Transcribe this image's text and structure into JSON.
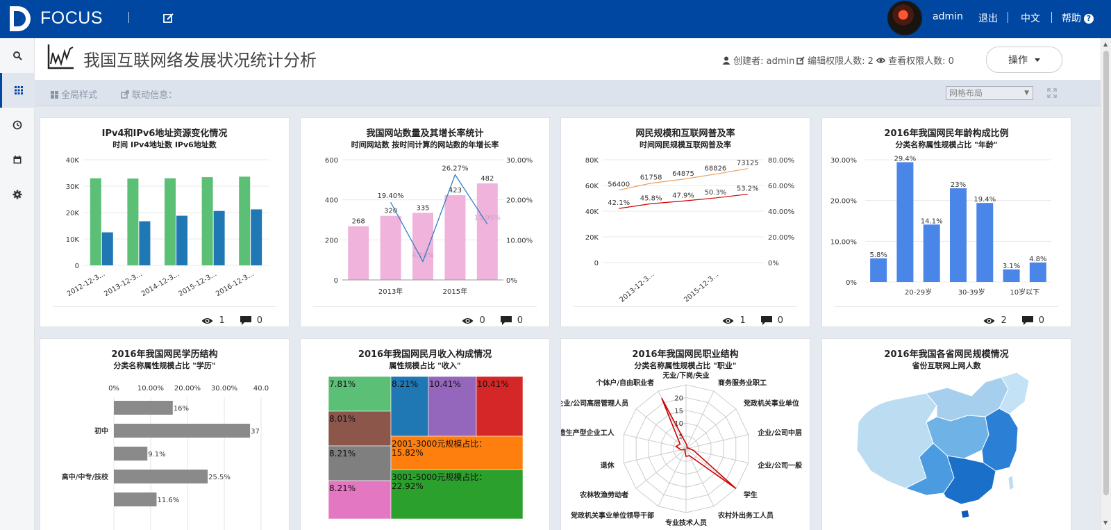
{
  "app": {
    "brand": "FOCUS"
  },
  "header": {
    "username": "admin",
    "logout": "退出",
    "language": "中文",
    "help": "帮助"
  },
  "page": {
    "title": "我国互联网络发展状况统计分析",
    "creator": "创建者: admin",
    "edit_count": "编辑权限人数: 2",
    "view_count": "查看权限人数: 0",
    "ops_button": "操作"
  },
  "toolbar": {
    "global_style": "全局样式",
    "linkage_info": "联动信息：",
    "layout_select": "网格布局"
  },
  "colors": {
    "brand": "#0047a1",
    "green": "#5bbf76",
    "blue": "#1f77b4",
    "pink": "#f0b3dc",
    "bar_blue": "#4a85e8",
    "gray_bar": "#8a8a8a",
    "red": "#cc0000",
    "orange": "#e8a25a"
  },
  "cards": [
    {
      "title": "IPv4和IPv6地址资源变化情况",
      "subtitle": "时间 IPv4地址数 IPv6地址数",
      "views": "1",
      "comments": "0",
      "chart_data": {
        "type": "bar",
        "categories": [
          "2012-12-3...",
          "2013-12-3...",
          "2014-12-3...",
          "2015-12-3...",
          "2016-12-3..."
        ],
        "series": [
          {
            "values": [
              33000,
              32900,
              33000,
              33400,
              33600
            ]
          },
          {
            "values": [
              12500,
              16700,
              18800,
              20600,
              21200
            ]
          }
        ],
        "yticks": [
          "0",
          "10K",
          "20K",
          "30K",
          "40K"
        ],
        "ylim": [
          0,
          40000
        ]
      }
    },
    {
      "title": "我国网站数量及其增长率统计",
      "subtitle": "时间网站数 按时间计算的网站数的年增长率",
      "views": "0",
      "comments": "0",
      "chart_data": {
        "type": "bar",
        "categories": [
          "",
          "2013年",
          "",
          "2015年",
          ""
        ],
        "values": [
          268,
          320,
          335,
          423,
          482
        ],
        "value_labels": [
          "268",
          "320",
          "335",
          "423",
          "482"
        ],
        "line": {
          "values": [
            null,
            19.4,
            4.6,
            26.27,
            13.95
          ],
          "labels": [
            "",
            "19.40%",
            "4.58%",
            "26.27%",
            "13.95%"
          ]
        },
        "yticks": [
          "0",
          "200",
          "400",
          "600"
        ],
        "ylim": [
          0,
          600
        ],
        "y2ticks": [
          "0%",
          "10.00%",
          "20.00%",
          "30.00%"
        ],
        "y2lim": [
          0,
          30
        ]
      }
    },
    {
      "title": "网民规模和互联网普及率",
      "subtitle": "时间网民规模互联网普及率",
      "views": "1",
      "comments": "0",
      "chart_data": {
        "type": "line",
        "categories": [
          "",
          "2013-12-3...",
          "",
          "2015-12-3...",
          ""
        ],
        "series": [
          {
            "values": [
              56400,
              61758,
              64875,
              68826,
              73125
            ],
            "labels": [
              "56400",
              "61758",
              "64875",
              "68826",
              "73125"
            ]
          },
          {
            "values": [
              42.1,
              45.8,
              47.9,
              50.3,
              53.2
            ],
            "labels": [
              "42.1%",
              "45.8%",
              "47.9%",
              "50.3%",
              "53.2%"
            ]
          }
        ],
        "yticks": [
          "0",
          "20K",
          "40K",
          "60K",
          "80K"
        ],
        "ylim": [
          0,
          80000
        ],
        "y2ticks": [
          "0%",
          "20.00%",
          "40.00%",
          "60.00%",
          "80.00%"
        ],
        "y2lim": [
          0,
          80
        ]
      }
    },
    {
      "title": "2016年我国网民年龄构成比例",
      "subtitle": "分类名称属性规模占比 \"年龄\"",
      "views": "2",
      "comments": "0",
      "chart_data": {
        "type": "bar",
        "categories": [
          "",
          "20-29岁",
          "",
          "30-39岁",
          "",
          "10岁以下",
          ""
        ],
        "values": [
          5.8,
          29.4,
          14.1,
          23,
          19.4,
          3.1,
          4.8
        ],
        "value_labels": [
          "5.8%",
          "29.4%",
          "14.1%",
          "23%",
          "19.4%",
          "3.1%",
          "4.8%"
        ],
        "yticks": [
          "0%",
          "10.00%",
          "20.00%",
          "30.00%"
        ],
        "ylim": [
          0,
          30
        ]
      }
    },
    {
      "title": "2016年我国网民学历结构",
      "subtitle": "分类名称属性规模占比 \"学历\"",
      "chart_data": {
        "type": "bar",
        "orientation": "horizontal",
        "categories": [
          "",
          "初中",
          "",
          "高中/中专/技校",
          ""
        ],
        "values": [
          16,
          37,
          9.1,
          25.5,
          11.6
        ],
        "value_labels": [
          "16%",
          "37",
          "9.1%",
          "25.5%",
          "11.6%"
        ],
        "xticks": [
          "0%",
          "10.00%",
          "20.00%",
          "30.00%",
          "40.0"
        ],
        "xlim": [
          0,
          40
        ]
      }
    },
    {
      "title": "2016年我国网民月收入构成情况",
      "subtitle": "属性规模占比 \"收入\"",
      "chart_data": {
        "type": "treemap",
        "cells": [
          {
            "label": "7.81%",
            "value": 7.81
          },
          {
            "label": "8.01%",
            "value": 8.01
          },
          {
            "label": "8.21%",
            "value": 8.21
          },
          {
            "label": "8.21%",
            "value": 8.21
          },
          {
            "label": "8.21%",
            "value": 8.21
          },
          {
            "label": "10.41%",
            "value": 10.41
          },
          {
            "label": "10.41%",
            "value": 10.41
          },
          {
            "label": "2001-3000元规模占比：15.82%",
            "value": 15.82
          },
          {
            "label": "3001-5000元规模占比：22.92%",
            "value": 22.92
          }
        ]
      }
    },
    {
      "title": "2016年我国网民职业结构",
      "subtitle": "分类名称属性规模占比 \"职业\"",
      "chart_data": {
        "type": "radar",
        "axes": [
          "无业/下岗/失业",
          "商务服务业职工",
          "党政机关事业单位",
          "企业/公司中层",
          "企业/公司一般",
          "学生",
          "农村外出务工人员",
          "专业技术人员",
          "党政机关事业单位领导干部",
          "农林牧渔劳动者",
          "退休",
          "制造生产型企业工人",
          "企业/公司高层管理人员",
          "个体户/自由职业者"
        ],
        "axis_labels": [
          "无业/下岗/失业",
          "商务服务业职工",
          "党政机关事业单位",
          "企业/公司中层",
          "企业/公司一般",
          "学生",
          "农村外出务工人员",
          "专业技术人员",
          "党政机关事业单位领导干部",
          "农林牧渔劳动者",
          "退休",
          "制造生产型企业工人",
          "企业/公司高层管理人员",
          "个体户/自由职业者"
        ],
        "values": [
          2,
          1,
          0.5,
          1,
          3,
          25,
          3,
          3,
          1,
          0.5,
          2,
          4,
          3,
          22
        ],
        "ticks": [
          "5",
          "10",
          "15",
          "20"
        ],
        "max": 25
      }
    },
    {
      "title": "2016年我国各省网民规模情况",
      "subtitle": "省份互联网上网人数",
      "chart_data": {
        "type": "map"
      }
    }
  ]
}
